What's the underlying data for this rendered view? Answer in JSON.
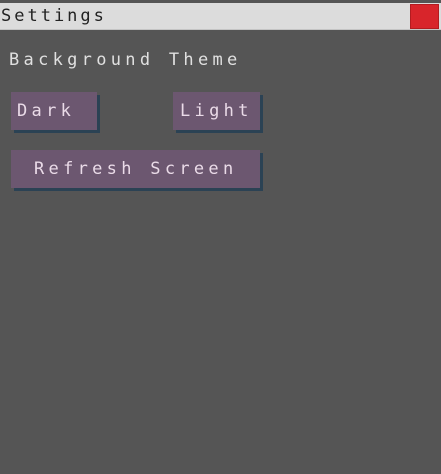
{
  "window": {
    "title": "Settings",
    "close_color": "#d8252b",
    "close_icon": "close-icon"
  },
  "background_section": {
    "label": "Background Theme",
    "dark_label": "Dark",
    "light_label": "Light"
  },
  "actions": {
    "refresh_label": "Refresh Screen"
  },
  "colors": {
    "window_background": "#555555",
    "titlebar": "#dcdcdc",
    "button_face": "#6c5770",
    "button_shadow": "#2b4254"
  }
}
